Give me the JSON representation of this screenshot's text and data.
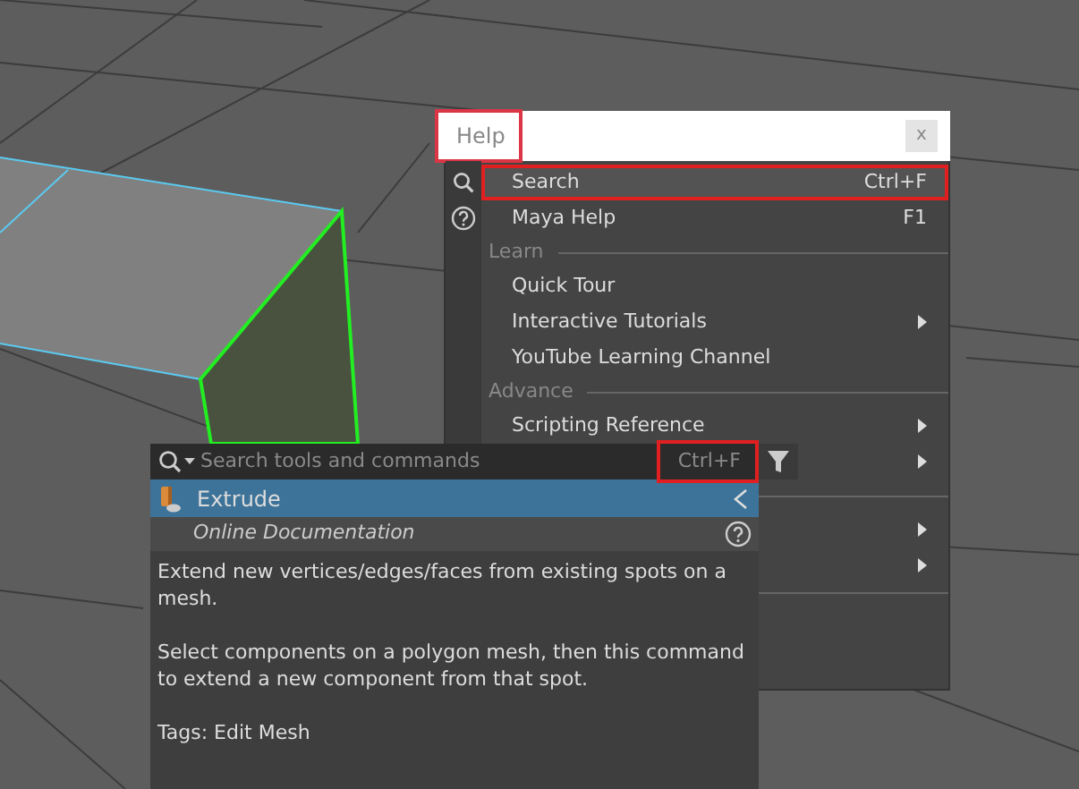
{
  "help_menu": {
    "title": "Help",
    "title_highlighted": true,
    "close": "x",
    "items": [
      {
        "kind": "item",
        "label": "Search",
        "shortcut": "Ctrl+F",
        "submenu": false,
        "highlighted": true,
        "selected": true
      },
      {
        "kind": "item",
        "label": "Maya Help",
        "shortcut": "F1",
        "submenu": false,
        "highlighted": false,
        "selected": false
      },
      {
        "kind": "header",
        "label": "Learn"
      },
      {
        "kind": "item",
        "label": "Quick Tour",
        "submenu": false,
        "highlighted": false,
        "selected": false
      },
      {
        "kind": "item",
        "label": "Interactive Tutorials",
        "submenu": true,
        "highlighted": false,
        "selected": false
      },
      {
        "kind": "item",
        "label": "YouTube Learning Channel",
        "submenu": false,
        "highlighted": false,
        "selected": false
      },
      {
        "kind": "header",
        "label": "Advance"
      },
      {
        "kind": "item",
        "label": "Scripting Reference",
        "submenu": true,
        "highlighted": false,
        "selected": false
      },
      {
        "kind": "item",
        "submenu": true,
        "highlighted": false,
        "selected": false
      },
      {
        "kind": "header"
      },
      {
        "kind": "item",
        "submenu": true,
        "highlighted": false,
        "selected": false
      },
      {
        "kind": "item",
        "submenu": true,
        "highlighted": false,
        "selected": false
      },
      {
        "kind": "divider"
      }
    ]
  },
  "search_panel": {
    "placeholder": "Search tools and commands",
    "shortcut": "Ctrl+F",
    "shortcut_highlighted": true,
    "results": [
      {
        "label": "Extrude",
        "selected": true
      }
    ],
    "doc_link": "Online Documentation",
    "description": [
      "Extend new vertices/edges/faces from existing spots on a mesh.",
      "Select components on a polygon mesh, then this command to extend a new component from that spot.",
      "Tags: Edit Mesh"
    ]
  }
}
